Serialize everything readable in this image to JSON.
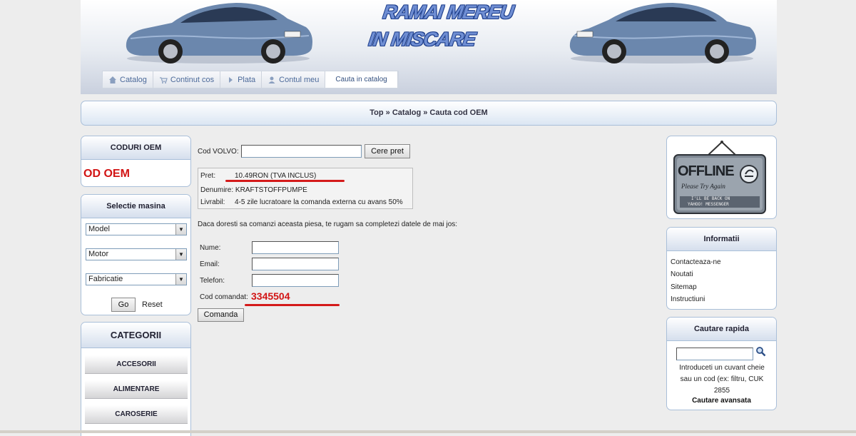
{
  "header": {
    "slogan_line1": "RAMAI MEREU",
    "slogan_line2": "IN MISCARE",
    "nav": [
      {
        "label": "Catalog",
        "icon": "home-icon"
      },
      {
        "label": "Continut cos",
        "icon": "cart-icon"
      },
      {
        "label": "Plata",
        "icon": "arrow-right-icon"
      },
      {
        "label": "Contul meu",
        "icon": "user-icon"
      },
      {
        "label": "Cauta in catalog",
        "icon": ""
      }
    ]
  },
  "breadcrumb": "Top » Catalog » Cauta cod OEM",
  "left": {
    "oem_title": "CODURI OEM",
    "oem_banner": "OD OEM",
    "car_title": "Selectie masina",
    "selects": [
      "Model",
      "Motor",
      "Fabricatie"
    ],
    "go_label": "Go",
    "reset_label": "Reset",
    "categories_title": "CATEGORII",
    "categories": [
      "ACCESORII",
      "ALIMENTARE",
      "CAROSERIE"
    ]
  },
  "center": {
    "cod_label": "Cod VOLVO:",
    "cod_value": "",
    "cere_pret_label": "Cere pret",
    "pret_label": "Pret:",
    "pret_value": "10.49RON (TVA INCLUS)",
    "denumire": "Denumire: KRAFTSTOFFPUMPE",
    "livrabil_label": "Livrabil:",
    "livrabil_value": "4-5 zile lucratoare la comanda externa cu avans 50%",
    "intro": "Daca doresti sa comanzi aceasta piesa, te rugam sa completezi datele de mai jos:",
    "nume_label": "Nume:",
    "email_label": "Email:",
    "telefon_label": "Telefon:",
    "cod_comandat_label": "Cod comandat:",
    "cod_comandat_value": "3345504",
    "comanda_label": "Comanda"
  },
  "right": {
    "offline_word": "OFFLINE",
    "offline_sub": "Please Try Again",
    "offline_msg1": "I'LL BE BACK ON",
    "offline_msg2": "YAHOO! MESSENGER",
    "info_title": "Informatii",
    "info_links": [
      "Contacteaza-ne",
      "Noutati",
      "Sitemap",
      "Instructiuni"
    ],
    "search_title": "Cautare rapida",
    "search_value": "",
    "search_hint": "Introduceti un cuvant cheie sau un cod (ex: filtru, CUK 2855",
    "advanced_label": "Cautare avansata"
  },
  "colors": {
    "accent_red": "#d21414",
    "nav_text": "#4c6a9a",
    "box_border": "#a9bfd9",
    "car_blue": "#6b87ad"
  }
}
